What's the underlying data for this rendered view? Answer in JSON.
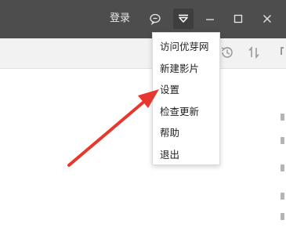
{
  "titlebar": {
    "login_label": "登录",
    "icons": [
      "chat-bubble-icon",
      "dropdown-menu-icon",
      "minimize-icon",
      "maximize-icon",
      "close-icon"
    ]
  },
  "toolbar": {
    "icons": [
      "history-clock-icon",
      "sort-arrows-icon"
    ]
  },
  "menu": {
    "items": [
      {
        "label": "访问优芽网"
      },
      {
        "label": "新建影片"
      },
      {
        "label": "设置"
      },
      {
        "label": "检查更新"
      },
      {
        "label": "帮助"
      },
      {
        "label": "退出"
      }
    ]
  },
  "colors": {
    "titlebar_bg": "#4d4d4d",
    "toolbar_bg": "#f2f2f2",
    "annotation_arrow": "#e8382d"
  }
}
